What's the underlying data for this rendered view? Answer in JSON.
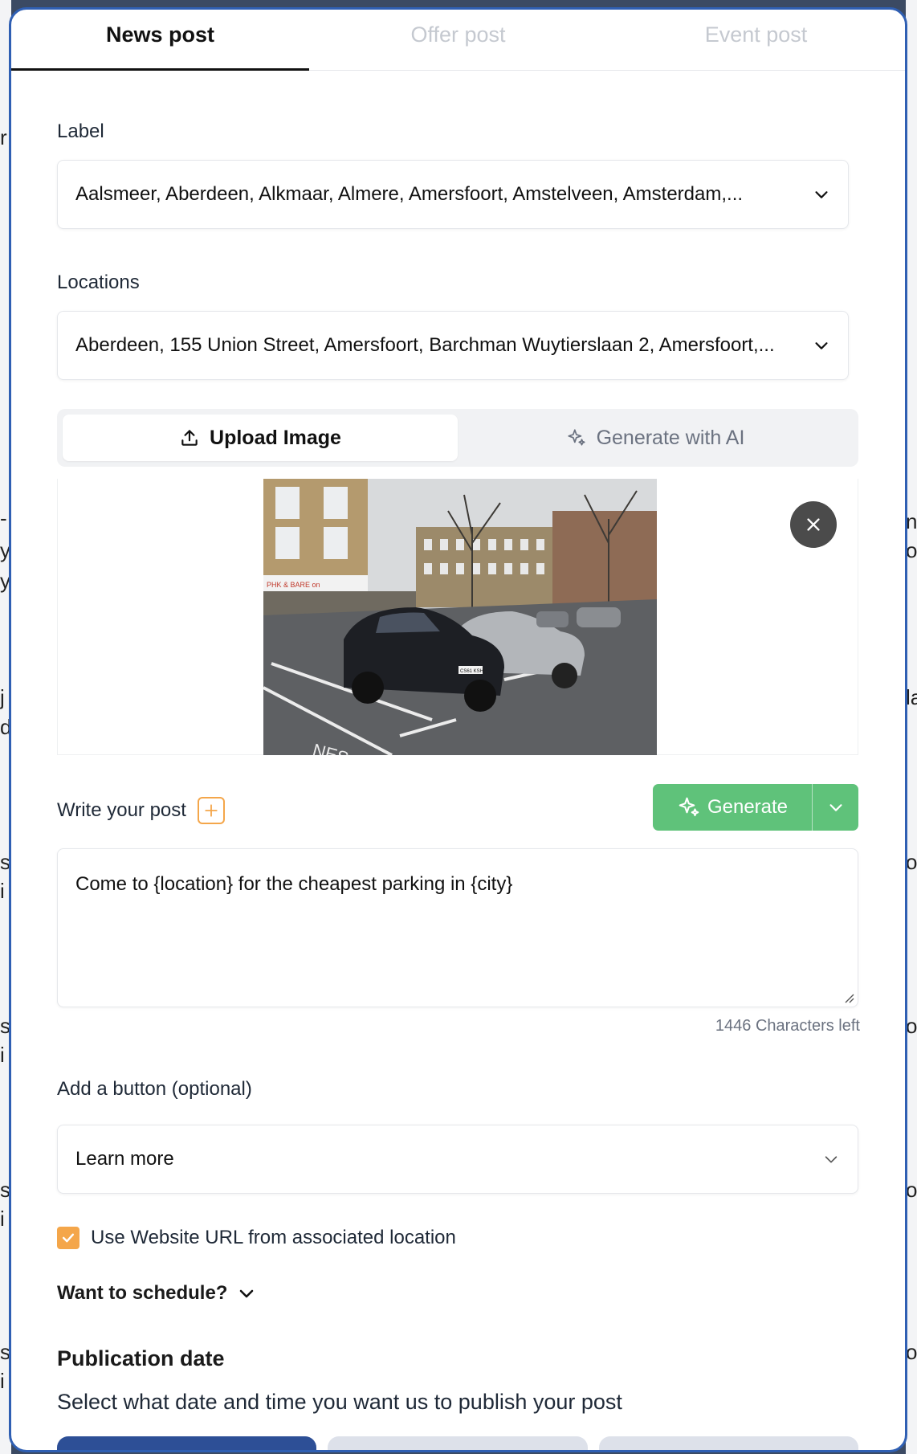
{
  "tabs": [
    {
      "label": "News post",
      "active": true
    },
    {
      "label": "Offer post",
      "active": false
    },
    {
      "label": "Event post",
      "active": false
    }
  ],
  "label_field": {
    "label": "Label",
    "value": "Aalsmeer, Aberdeen, Alkmaar, Almere, Amersfoort, Amstelveen, Amsterdam,..."
  },
  "locations_field": {
    "label": "Locations",
    "value": "Aberdeen, 155 Union Street, Amersfoort, Barchman Wuytierslaan 2, Amersfoort,..."
  },
  "image_source": {
    "upload_label": "Upload Image",
    "ai_label": "Generate with AI",
    "active": "upload"
  },
  "write_post": {
    "label": "Write your post",
    "generate_label": "Generate",
    "text": "Come to {location} for the cheapest parking in {city}",
    "chars_left": "1446 Characters left"
  },
  "button_field": {
    "label": "Add a button (optional)",
    "value": "Learn more"
  },
  "use_website": {
    "label": "Use Website URL from associated location",
    "checked": true
  },
  "schedule": {
    "label": "Want to schedule?"
  },
  "publication": {
    "title": "Publication date",
    "subtitle": "Select what date and time you want us to publish your post"
  },
  "photo_text": {
    "shop_sign": "PHK & BARE on",
    "plate": "CS61 KSH",
    "road_marking": "NES"
  },
  "colors": {
    "accent_orange": "#f4a64a",
    "generate_green": "#5fc27a",
    "primary_blue": "#2d4f96",
    "modal_border": "#2f5fb3"
  },
  "background_fragments": {
    "left": [
      "r",
      "-",
      "y",
      "y",
      "j",
      "d",
      "s",
      "i",
      "s",
      "i",
      "s",
      "i",
      "s",
      "i"
    ],
    "right": [
      "ng",
      "or",
      "la",
      "ou",
      "ou",
      "ou",
      "ou"
    ]
  }
}
